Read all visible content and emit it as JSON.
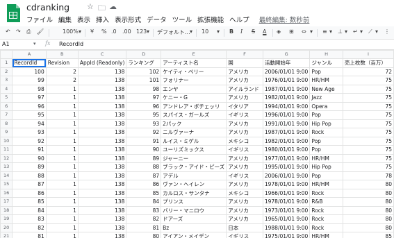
{
  "app": {
    "doc_title": "cdranking",
    "menu": [
      "ファイル",
      "編集",
      "表示",
      "挿入",
      "表示形式",
      "データ",
      "ツール",
      "拡張機能",
      "ヘルプ"
    ],
    "last_edit": "最終編集: 数秒前",
    "brand_color": "#0f9d58"
  },
  "toolbar": {
    "zoom": "100%",
    "currency": "¥",
    "percent": "%",
    "decimal_dec": ".0",
    "decimal_inc": ".00",
    "number_format": "123",
    "font": "デフォルト...",
    "font_size": "10",
    "bold": "B",
    "italic": "I",
    "strike": "S",
    "text_color": "A"
  },
  "formula_bar": {
    "cell_ref": "A1",
    "fx": "fx",
    "content": "RecordId"
  },
  "grid": {
    "columns": [
      "A",
      "B",
      "C",
      "D",
      "E",
      "F",
      "G",
      "H",
      "I"
    ],
    "headers": [
      "RecordId",
      "Revision",
      "AppId (Readonly)",
      "ランキング",
      "アーティスト名",
      "国",
      "活動開始年",
      "ジャンル",
      "売上枚数（百万）"
    ],
    "rows": [
      [
        "100",
        "2",
        "138",
        "102",
        "ケイティ・ペリー",
        "アメリカ",
        "2006/01/01 9:00",
        "Pop",
        "72"
      ],
      [
        "99",
        "2",
        "138",
        "101",
        "フォリナー",
        "アメリカ",
        "1976/01/01 9:00",
        "HR/HM",
        "75"
      ],
      [
        "98",
        "1",
        "138",
        "98",
        "エンヤ",
        "アイルランド",
        "1987/01/01 9:00",
        "New Age",
        "75"
      ],
      [
        "97",
        "1",
        "138",
        "97",
        "ケニー・G",
        "アメリカ",
        "1982/01/01 9:00",
        "Jazz",
        "75"
      ],
      [
        "96",
        "1",
        "138",
        "96",
        "アンドレア・ボチェッリ",
        "イタリア",
        "1994/01/01 9:00",
        "Opera",
        "75"
      ],
      [
        "95",
        "1",
        "138",
        "95",
        "スパイス・ガールズ",
        "イギリス",
        "1996/01/01 9:00",
        "Pop",
        "75"
      ],
      [
        "94",
        "1",
        "138",
        "93",
        "2パック",
        "アメリカ",
        "1991/01/01 9:00",
        "Hip Pop",
        "75"
      ],
      [
        "93",
        "1",
        "138",
        "92",
        "ニルヴァーナ",
        "アメリカ",
        "1987/01/01 9:00",
        "Rock",
        "75"
      ],
      [
        "92",
        "1",
        "138",
        "91",
        "ルイス・ミゲル",
        "メキシコ",
        "1982/01/01 9:00",
        "Pop",
        "75"
      ],
      [
        "91",
        "1",
        "138",
        "90",
        "ユーリズミックス",
        "イギリス",
        "1980/01/01 9:00",
        "Pop",
        "75"
      ],
      [
        "90",
        "1",
        "138",
        "89",
        "ジャーニー",
        "アメリカ",
        "1977/01/01 9:00",
        "HR/HM",
        "75"
      ],
      [
        "89",
        "1",
        "138",
        "88",
        "ブラック・アイド・ピーズ",
        "アメリカ",
        "1995/01/01 9:00",
        "Hip Pop",
        "75"
      ],
      [
        "88",
        "1",
        "138",
        "87",
        "アデル",
        "イギリス",
        "2006/01/01 9:00",
        "Pop",
        "78"
      ],
      [
        "87",
        "1",
        "138",
        "86",
        "ヴァン・ヘイレン",
        "アメリカ",
        "1978/01/01 9:00",
        "HR/HM",
        "80"
      ],
      [
        "86",
        "1",
        "138",
        "85",
        "カルロス・サンタナ",
        "メキシコ",
        "1966/01/01 9:00",
        "Rock",
        "80"
      ],
      [
        "85",
        "1",
        "138",
        "84",
        "プリンス",
        "アメリカ",
        "1978/01/01 9:00",
        "R&B",
        "80"
      ],
      [
        "84",
        "1",
        "138",
        "83",
        "バリー・マニロウ",
        "アメリカ",
        "1973/01/01 9:00",
        "Rock",
        "80"
      ],
      [
        "83",
        "1",
        "138",
        "82",
        "ドアーズ",
        "アメリカ",
        "1965/01/01 9:00",
        "Rock",
        "80"
      ],
      [
        "82",
        "1",
        "138",
        "81",
        "Bz",
        "日本",
        "1988/01/01 9:00",
        "Rock",
        "80"
      ],
      [
        "81",
        "1",
        "138",
        "80",
        "アイアン・メイデン",
        "イギリス",
        "1975/01/01 9:00",
        "HR/HM",
        "85"
      ]
    ]
  }
}
